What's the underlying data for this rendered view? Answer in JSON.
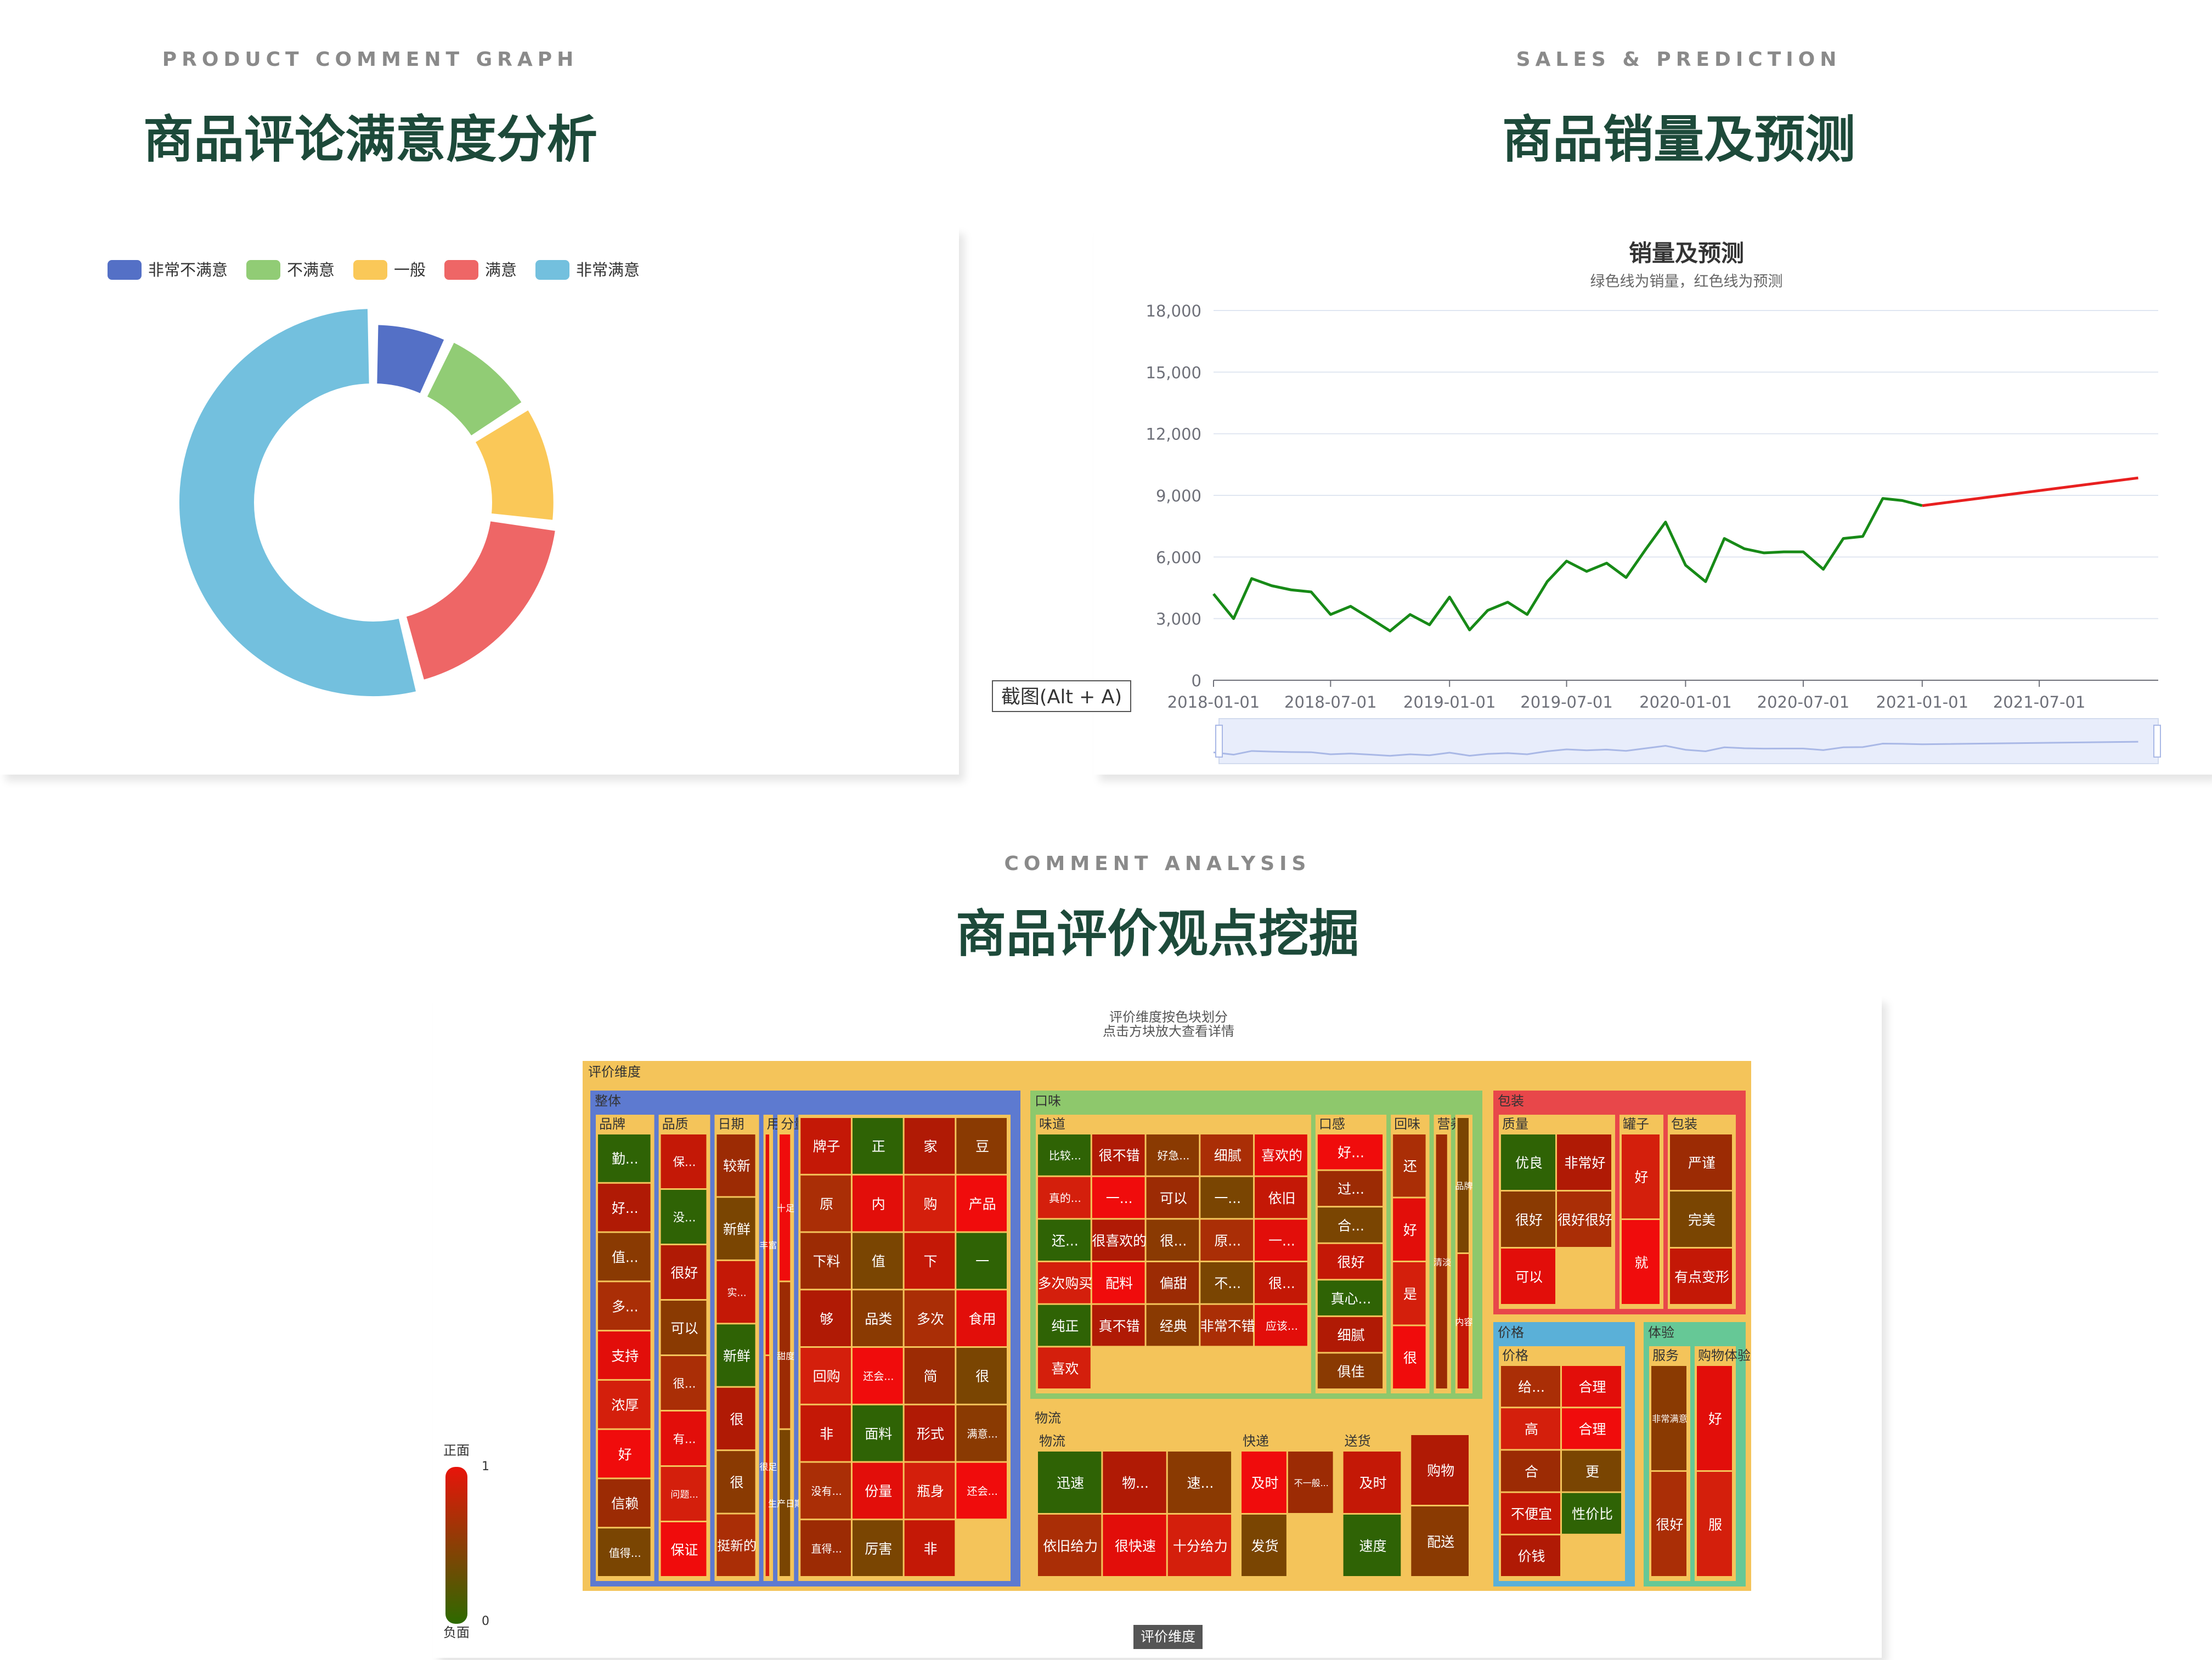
{
  "sections": {
    "comment": {
      "eyebrow": "PRODUCT COMMENT GRAPH",
      "title": "商品评论满意度分析"
    },
    "sales": {
      "eyebrow": "SALES & PREDICTION",
      "title": "商品销量及预测"
    },
    "analysis": {
      "eyebrow": "COMMENT ANALYSIS",
      "title": "商品评价观点挖掘"
    }
  },
  "screenshot_button": "截图(Alt + A)",
  "colors": {
    "heading": "#1d4a3a",
    "sales_line": "#178a17",
    "prediction_line": "#e82020",
    "pie": [
      "#5470c6",
      "#91cc75",
      "#fac858",
      "#ee6666",
      "#73c0de"
    ],
    "treemap_positive": "#e8140a",
    "treemap_negative": "#2d6a00",
    "treemap_root": "#f4c45a"
  },
  "chart_data": [
    {
      "type": "pie",
      "style": "donut",
      "legend": [
        "非常不满意",
        "不满意",
        "一般",
        "满意",
        "非常满意"
      ],
      "legend_position": "top-left",
      "values": [
        7,
        9,
        11,
        19,
        54
      ],
      "value_unit": "percent (estimated)"
    },
    {
      "type": "line",
      "title": "销量及预测",
      "subtitle": "绿色线为销量，红色线为预测",
      "y_ticks": [
        "0",
        "3,000",
        "6,000",
        "9,000",
        "12,000",
        "15,000",
        "18,000"
      ],
      "x_ticks": [
        "2018-01-01",
        "2018-07-01",
        "2019-01-01",
        "2019-07-01",
        "2020-01-01",
        "2020-07-01",
        "2021-01-01",
        "2021-07-01"
      ],
      "ylim": [
        0,
        18000
      ],
      "xlim": [
        "2018-01-01",
        "2022-01-01"
      ],
      "grid": true,
      "data_zoom": true,
      "series": [
        {
          "role": "sales",
          "color": "#178a17",
          "points": [
            [
              "2018-01-01",
              4200
            ],
            [
              "2018-02-01",
              3000
            ],
            [
              "2018-03-01",
              4950
            ],
            [
              "2018-04-01",
              4600
            ],
            [
              "2018-05-01",
              4400
            ],
            [
              "2018-06-01",
              4300
            ],
            [
              "2018-07-01",
              3200
            ],
            [
              "2018-08-01",
              3600
            ],
            [
              "2018-09-01",
              3000
            ],
            [
              "2018-10-01",
              2400
            ],
            [
              "2018-11-01",
              3200
            ],
            [
              "2018-12-01",
              2700
            ],
            [
              "2019-01-01",
              4050
            ],
            [
              "2019-02-01",
              2450
            ],
            [
              "2019-03-01",
              3400
            ],
            [
              "2019-04-01",
              3800
            ],
            [
              "2019-05-01",
              3200
            ],
            [
              "2019-06-01",
              4800
            ],
            [
              "2019-07-01",
              5800
            ],
            [
              "2019-08-01",
              5300
            ],
            [
              "2019-09-01",
              5700
            ],
            [
              "2019-10-01",
              5000
            ],
            [
              "2019-11-01",
              6400
            ],
            [
              "2019-12-01",
              7700
            ],
            [
              "2020-01-01",
              5600
            ],
            [
              "2020-02-01",
              4800
            ],
            [
              "2020-03-01",
              6900
            ],
            [
              "2020-04-01",
              6400
            ],
            [
              "2020-05-01",
              6200
            ],
            [
              "2020-06-01",
              6250
            ],
            [
              "2020-07-01",
              6250
            ],
            [
              "2020-08-01",
              5400
            ],
            [
              "2020-09-01",
              6900
            ],
            [
              "2020-10-01",
              7000
            ],
            [
              "2020-11-01",
              8850
            ],
            [
              "2020-12-01",
              8750
            ],
            [
              "2021-01-01",
              8500
            ]
          ]
        },
        {
          "role": "prediction",
          "color": "#e82020",
          "points": [
            [
              "2021-01-01",
              8500
            ],
            [
              "2021-12-01",
              9850
            ]
          ]
        }
      ]
    },
    {
      "type": "treemap",
      "note_lines": [
        "评价维度按色块划分",
        "点击方块放大查看详情"
      ],
      "root": "评价维度",
      "breadcrumb": "评价维度",
      "visual_map": {
        "top_label": "正面",
        "bottom_label": "负面",
        "max": "1",
        "min": "0"
      },
      "groups": [
        {
          "name": "整体",
          "color": "#5d7ad0",
          "subgroups": [
            {
              "name": "品牌",
              "cells": [
                "勤...",
                "好...",
                "值...",
                "多...",
                "支持",
                "浓厚",
                "好",
                "信赖",
                "值得..."
              ]
            },
            {
              "name": "品质",
              "cells": [
                "保...",
                "没...",
                "很好",
                "可以",
                "很...",
                "有...",
                "问题...",
                "保证"
              ]
            },
            {
              "name": "日期",
              "cells": [
                "较新",
                "新鲜",
                "实...",
                "新鲜",
                "很",
                "很",
                "挺新的"
              ]
            },
            {
              "name": "用料",
              "cells": [
                "丰富",
                "很足"
              ]
            },
            {
              "name": "分量",
              "cells": [
                "十足",
                "甜度",
                "生产日期"
              ]
            },
            {
              "name": "",
              "cells": [
                "牌子",
                "正",
                "家",
                "豆",
                "原",
                "内",
                "购",
                "产品",
                "下料",
                "值",
                "下",
                "一",
                "够",
                "品类",
                "多次",
                "食用",
                "回购",
                "还会...",
                "简",
                "很",
                "非",
                "面料",
                "形式",
                "满意...",
                "没有...",
                "份量",
                "瓶身",
                "还会...",
                "直得...",
                "厉害",
                "非"
              ]
            }
          ]
        },
        {
          "name": "口味",
          "color": "#8ec86c",
          "subgroups": [
            {
              "name": "味道",
              "cells": [
                "比较...",
                "很不错",
                "好急...",
                "细腻",
                "喜欢的",
                "真的...",
                "一...",
                "可以",
                "一...",
                "依旧",
                "还...",
                "很喜欢的",
                "很...",
                "原...",
                "一...",
                "多次购买",
                "配料",
                "偏甜",
                "不...",
                "很...",
                "纯正",
                "真不错",
                "经典",
                "非常不错",
                "应该...",
                "喜欢"
              ]
            },
            {
              "name": "口感",
              "cells": [
                "好...",
                "过...",
                "合...",
                "很好",
                "真心...",
                "细腻",
                "俱佳"
              ]
            },
            {
              "name": "回味",
              "cells": [
                "还",
                "好",
                "是",
                "很"
              ]
            },
            {
              "name": "营养",
              "cells": [
                "清淡"
              ]
            },
            {
              "name": "",
              "cells": [
                "品牌",
                "内容"
              ]
            }
          ]
        },
        {
          "name": "包装",
          "color": "#e8474a",
          "subgroups": [
            {
              "name": "质量",
              "cells": [
                "优良",
                "非常好",
                "很好",
                "很好很好",
                "可以"
              ]
            },
            {
              "name": "罐子",
              "cells": [
                "好",
                "就"
              ]
            },
            {
              "name": "包装",
              "cells": [
                "严谨",
                "完美",
                "有点变形"
              ]
            }
          ]
        },
        {
          "name": "物流",
          "color": "#f4c45a",
          "subgroups": [
            {
              "name": "物流",
              "cells": [
                "迅速",
                "物...",
                "速...",
                "依旧给力",
                "很快速",
                "十分给力"
              ]
            },
            {
              "name": "快递",
              "cells": [
                "及时",
                "不一般...",
                "发货"
              ]
            },
            {
              "name": "送货",
              "cells": [
                "及时",
                "速度"
              ]
            },
            {
              "name": "",
              "cells": [
                "购物",
                "配送"
              ]
            }
          ]
        },
        {
          "name": "价格",
          "color": "#5ab0d8",
          "subgroups": [
            {
              "name": "价格",
              "cells": [
                "给...",
                "合理",
                "高",
                "合理",
                "合",
                "更",
                "不便宜",
                "性价比",
                "价钱"
              ]
            }
          ]
        },
        {
          "name": "体验",
          "color": "#66c896",
          "subgroups": [
            {
              "name": "服务",
              "cells": [
                "非常满意",
                "很好"
              ]
            },
            {
              "name": "购物体验",
              "cells": [
                "好",
                "服"
              ]
            }
          ]
        }
      ]
    }
  ]
}
